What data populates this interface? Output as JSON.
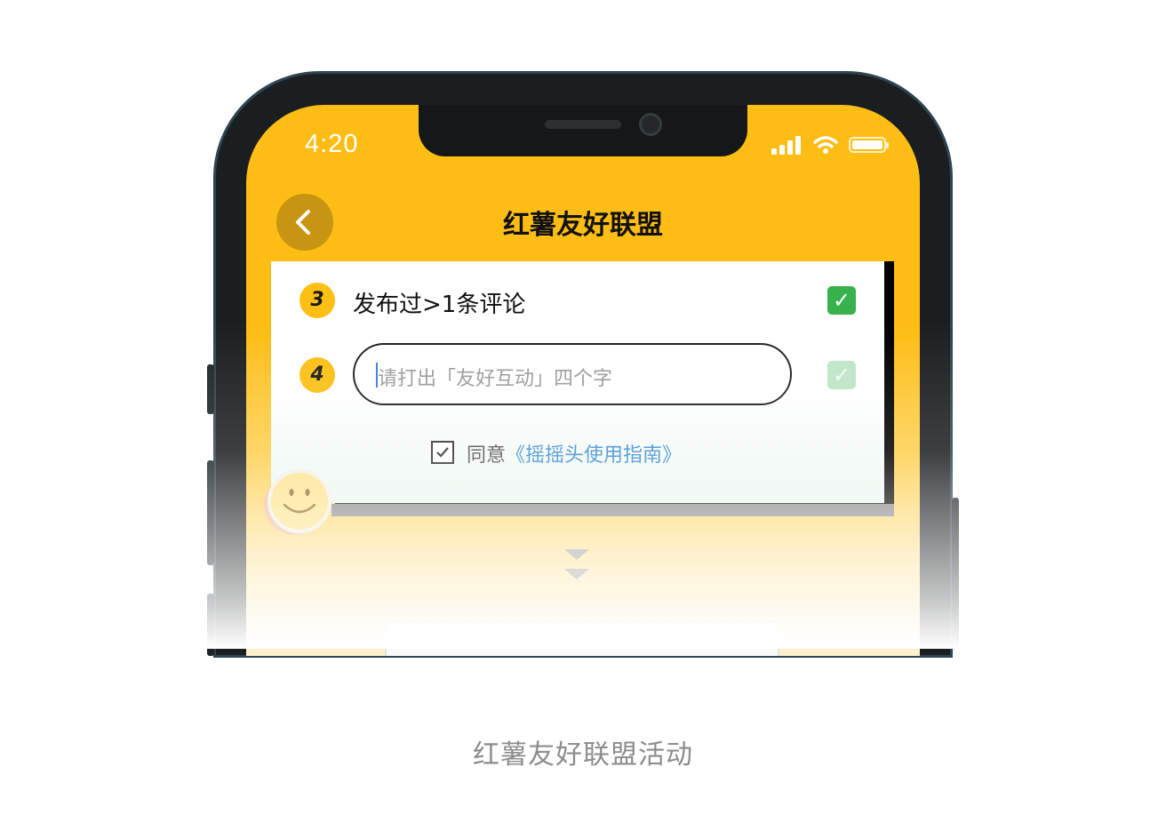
{
  "status_bar": {
    "time": "4:20",
    "icons": [
      "signal-icon",
      "wifi-icon",
      "battery-icon"
    ]
  },
  "nav": {
    "back_icon": "chevron-left-icon",
    "title": "红薯友好联盟"
  },
  "tasks": [
    {
      "number": "3",
      "label": "发布过>1条评论",
      "completed": true
    },
    {
      "number": "4",
      "input_placeholder": "请打出「友好互动」四个字",
      "input_value": "",
      "completed": false
    }
  ],
  "agreement": {
    "checked": true,
    "prefix": "同意",
    "link_text": "《摇摇头使用指南》"
  },
  "decorations": [
    "smiley-icon",
    "double-chevron-down-icon"
  ],
  "caption": "红薯友好联盟活动",
  "colors": {
    "primary_yellow": "#febd14",
    "back_button": "#c89512",
    "check_green": "#37b24d",
    "link_blue": "#3f8fd2"
  }
}
